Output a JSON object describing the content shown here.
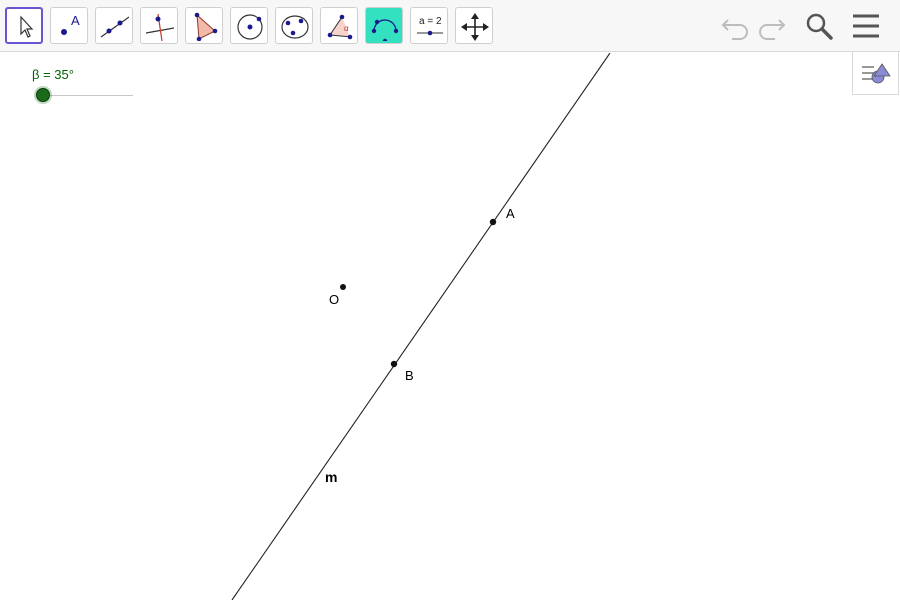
{
  "toolbar": {
    "tools": [
      {
        "name": "move-tool",
        "active": true
      },
      {
        "name": "point-tool",
        "active": false,
        "label": "A"
      },
      {
        "name": "line-tool",
        "active": false
      },
      {
        "name": "perpendicular-line-tool",
        "active": false
      },
      {
        "name": "polygon-tool",
        "active": false
      },
      {
        "name": "circle-center-point-tool",
        "active": false
      },
      {
        "name": "conic-through-points-tool",
        "active": false
      },
      {
        "name": "angle-tool",
        "active": false,
        "label": "α"
      },
      {
        "name": "reflect-tool",
        "active": false
      },
      {
        "name": "slider-tool",
        "active": false,
        "label": "a = 2"
      },
      {
        "name": "move-graphics-view-tool",
        "active": false
      }
    ],
    "right_icons": [
      "undo-icon",
      "redo-icon",
      "search-icon",
      "menu-icon"
    ]
  },
  "slider": {
    "label": "β = 35°",
    "value_fraction": 0.0
  },
  "points": {
    "A": {
      "label": "A"
    },
    "B": {
      "label": "B"
    },
    "O": {
      "label": "O"
    }
  },
  "line": {
    "label": "m"
  },
  "colors": {
    "accent": "#6557d2",
    "slider_green": "#006400",
    "reflect_bg": "#33e0c0"
  }
}
